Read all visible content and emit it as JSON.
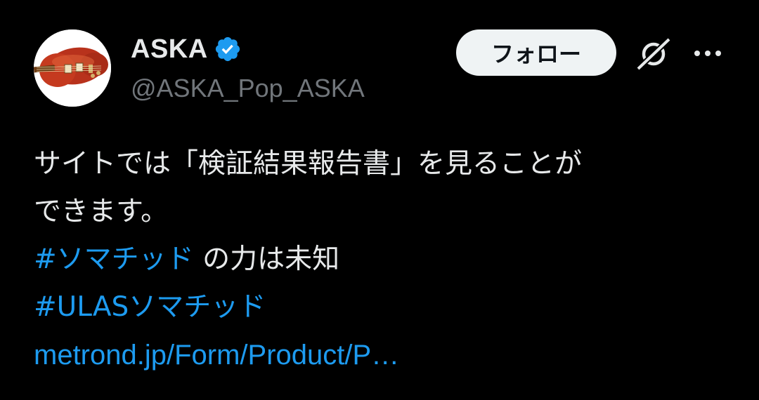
{
  "author": {
    "display_name": "ASKA",
    "handle": "@ASKA_Pop_ASKA",
    "verified_icon": "verified-badge-icon"
  },
  "actions": {
    "follow_label": "フォロー",
    "grok_icon": "grok-icon",
    "more_icon": "more-dots-icon"
  },
  "tweet": {
    "line1": "サイトでは「検証結果報告書」を見ることが",
    "line2": "できます。",
    "hashtag1": "#ソマチッド",
    "line3_rest": " の力は未知",
    "hashtag2": "#ULASソマチッド",
    "link": "metrond.jp/Form/Product/P…"
  },
  "colors": {
    "background": "#000000",
    "text": "#e7e9ea",
    "secondary": "#71767b",
    "accent": "#1d9bf0",
    "button_bg": "#eff3f4"
  }
}
